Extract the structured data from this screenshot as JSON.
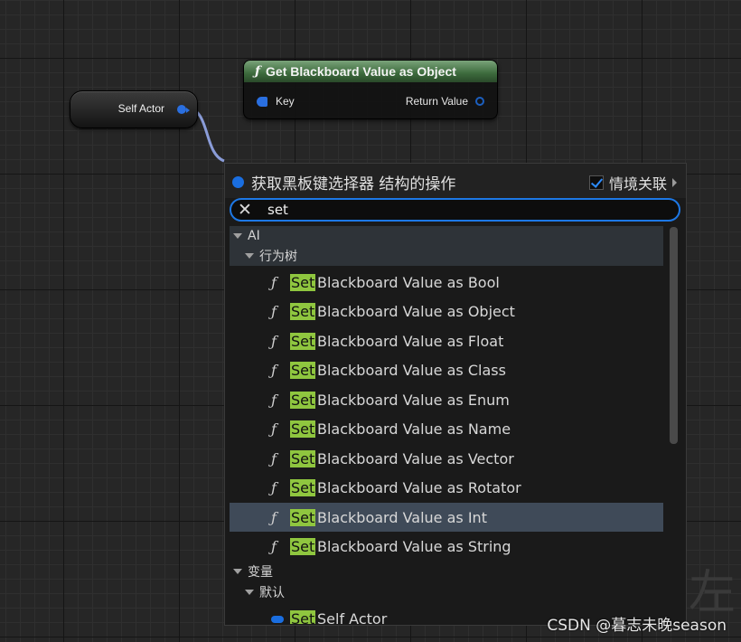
{
  "nodes": {
    "self_actor": {
      "label": "Self Actor"
    },
    "get_blackboard": {
      "title": "Get Blackboard Value as Object",
      "input_label": "Key",
      "output_label": "Return Value"
    }
  },
  "menu": {
    "title": "获取黑板键选择器 结构的操作",
    "context_sensitive_label": "情境关联",
    "context_sensitive_checked": true,
    "search_value": "set",
    "categories": {
      "ai": "AI",
      "behavior_tree": "行为树",
      "variables": "变量",
      "default": "默认"
    },
    "items": [
      {
        "highlight": "Set",
        "rest": "Blackboard Value as Bool"
      },
      {
        "highlight": "Set",
        "rest": "Blackboard Value as Object"
      },
      {
        "highlight": "Set",
        "rest": "Blackboard Value as Float"
      },
      {
        "highlight": "Set",
        "rest": "Blackboard Value as Class"
      },
      {
        "highlight": "Set",
        "rest": "Blackboard Value as Enum"
      },
      {
        "highlight": "Set",
        "rest": "Blackboard Value as Name"
      },
      {
        "highlight": "Set",
        "rest": "Blackboard Value as Vector"
      },
      {
        "highlight": "Set",
        "rest": "Blackboard Value as Rotator"
      },
      {
        "highlight": "Set",
        "rest": "Blackboard Value as Int",
        "selected": true
      },
      {
        "highlight": "Set",
        "rest": "Blackboard Value as String"
      }
    ],
    "variable_item": {
      "highlight": "Set",
      "rest": "Self Actor"
    },
    "function_icon": "ƒ"
  },
  "watermark": "CSDN @暮志未晚season",
  "corner_glyph": "左",
  "colors": {
    "accent": "#1d78e6",
    "highlight": "#8fc63f",
    "selected_row": "#3f4a58",
    "node_header": "#3c6a3c"
  }
}
